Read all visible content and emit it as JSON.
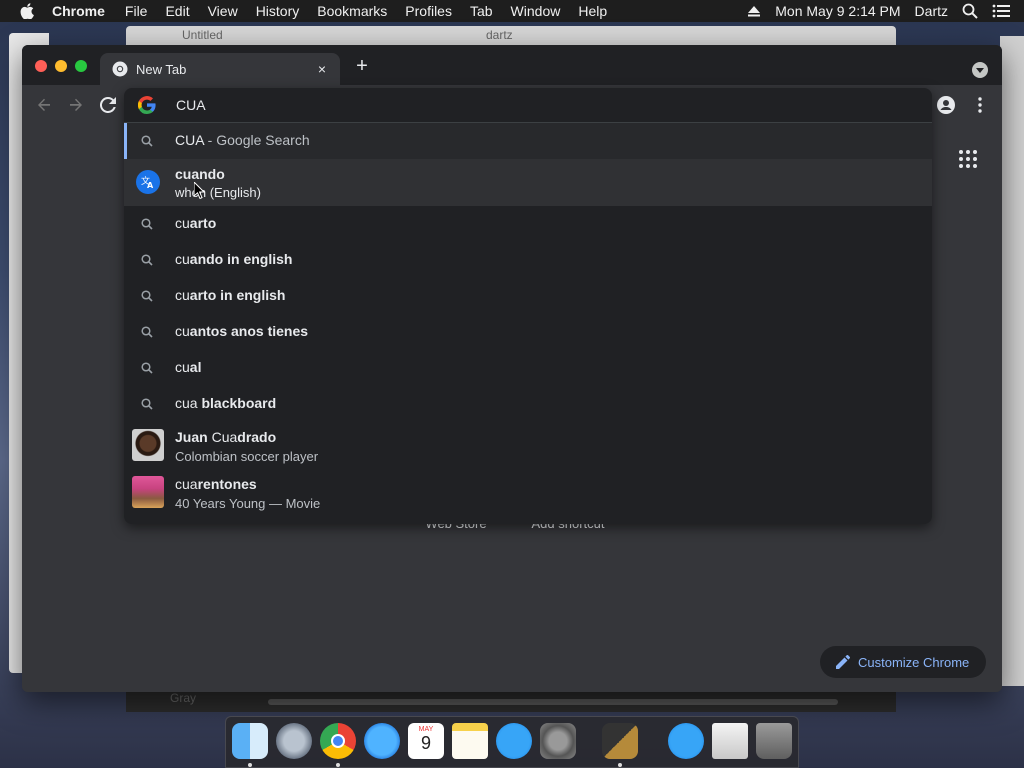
{
  "menubar": {
    "app_name": "Chrome",
    "items": [
      "File",
      "Edit",
      "View",
      "History",
      "Bookmarks",
      "Profiles",
      "Tab",
      "Window",
      "Help"
    ],
    "clock": "Mon May 9  2:14 PM",
    "user": "Dartz"
  },
  "background_windows": {
    "title_left": "Untitled",
    "title_right": "dartz",
    "bottom_text": "Gray"
  },
  "tab": {
    "title": "New Tab",
    "close_label": "×",
    "new_tab_label": "+"
  },
  "omnibox": {
    "value": "CUA",
    "suggestions": [
      {
        "type": "search",
        "query": "CUA",
        "suffix": " - Google Search",
        "selected": true
      },
      {
        "type": "translate",
        "title": "cuando",
        "subtitle": "when (English)",
        "hover": true
      },
      {
        "type": "search",
        "typed": "cu",
        "rest": "arto"
      },
      {
        "type": "search",
        "typed": "cu",
        "rest": "ando in english"
      },
      {
        "type": "search",
        "typed": "cu",
        "rest": "arto in english"
      },
      {
        "type": "search",
        "typed": "cu",
        "rest": "antos anos tienes"
      },
      {
        "type": "search",
        "typed": "cu",
        "rest": "al"
      },
      {
        "type": "search",
        "typed": "cua",
        "rest": " blackboard"
      },
      {
        "type": "entity",
        "title_plain": "Juan ",
        "title_typed": "Cua",
        "title_rest": "drado",
        "subtitle": "Colombian soccer player"
      },
      {
        "type": "entity",
        "title_plain": "",
        "title_typed": "cua",
        "title_rest": "rentones",
        "subtitle": "40 Years Young — Movie"
      }
    ]
  },
  "ntp": {
    "shortcuts": [
      {
        "label": "Web Store"
      },
      {
        "label": "Add shortcut"
      }
    ],
    "customize_label": "Customize Chrome"
  },
  "colors": {
    "accent": "#8ab4f8",
    "chrome_bg": "#35363a",
    "popup_bg": "#202124"
  },
  "dock": {
    "icons": [
      "finder-icon",
      "launchpad-icon",
      "chrome-icon",
      "safari-icon",
      "calendar-icon",
      "notes-icon",
      "app-store-icon",
      "system-preferences-icon",
      "xcode-icon",
      "app-store-icon-2",
      "downloads-icon",
      "trash-icon"
    ],
    "calendar": {
      "month": "MAY",
      "day": "9"
    }
  }
}
